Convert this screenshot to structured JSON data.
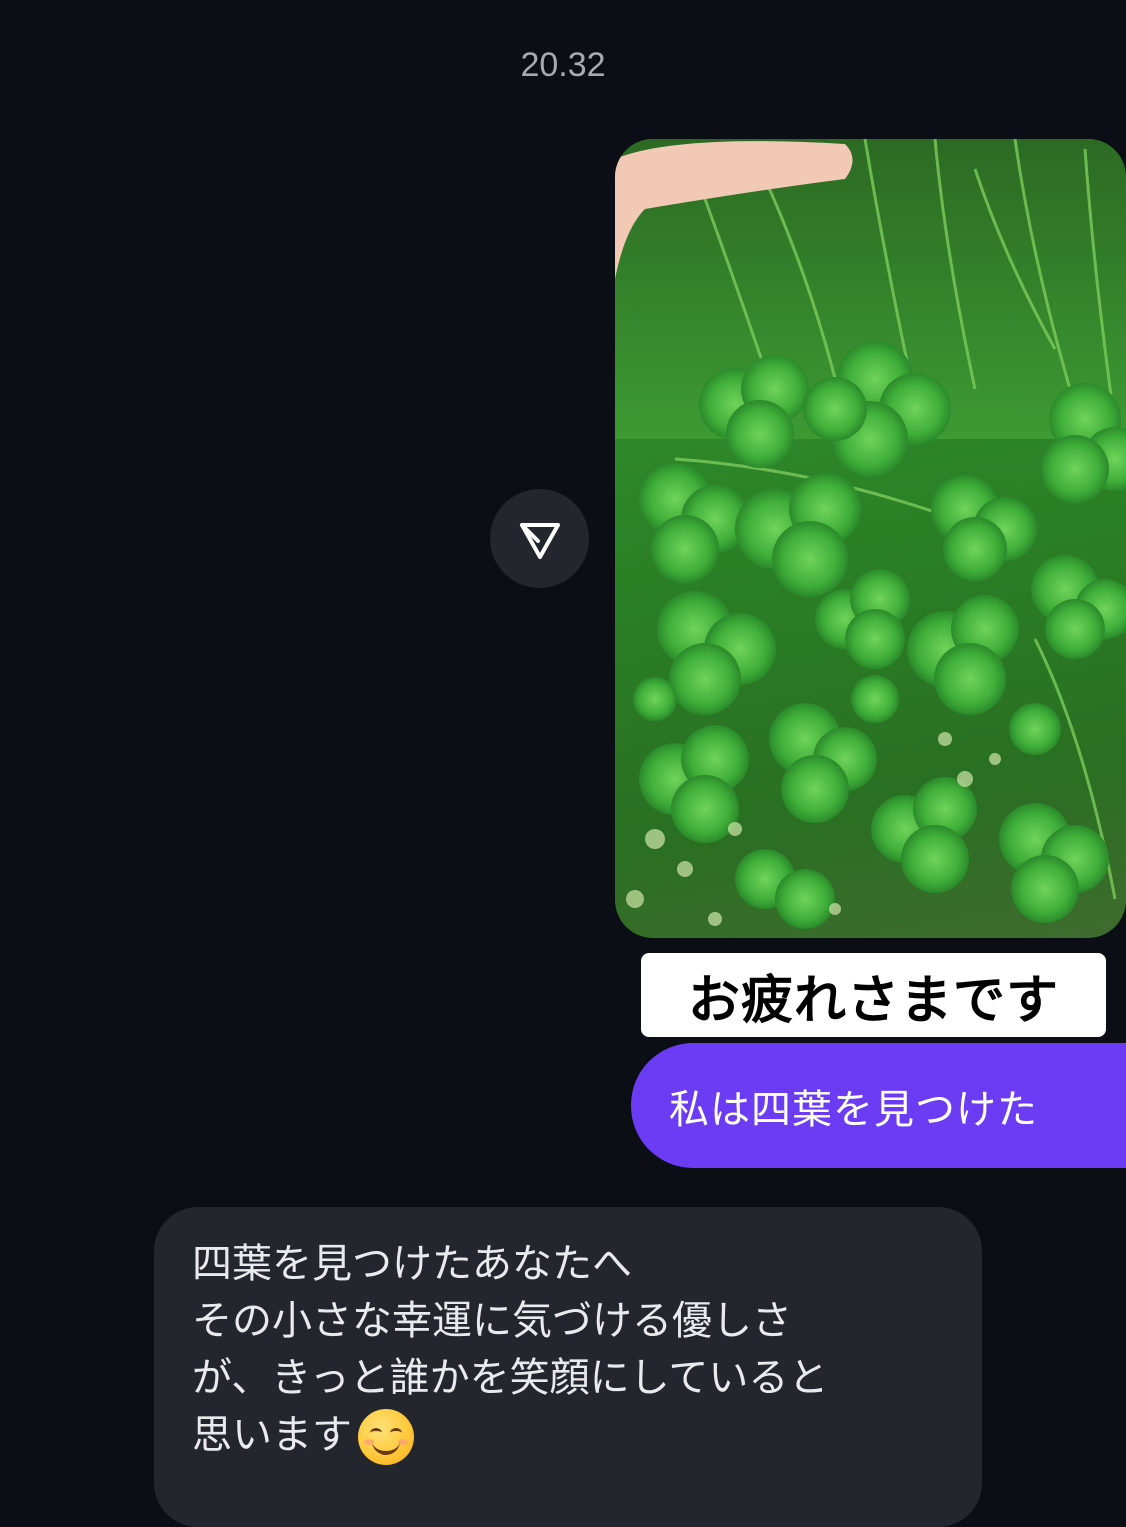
{
  "thread": {
    "timestamp": "20.32"
  },
  "sent_photo": {
    "description_icon": "photo",
    "caption": "お疲れさまです"
  },
  "share_icon": "send-icon",
  "sent_message": {
    "text": "私は四葉を見つけた",
    "color": "#6b3cf4"
  },
  "received_message": {
    "lines": [
      "四葉を見つけたあなたへ",
      "その小さな幸運に気づける優しさ",
      "が、きっと誰かを笑顔にしていると",
      "思います"
    ],
    "emoji": "smiling-face-icon"
  }
}
